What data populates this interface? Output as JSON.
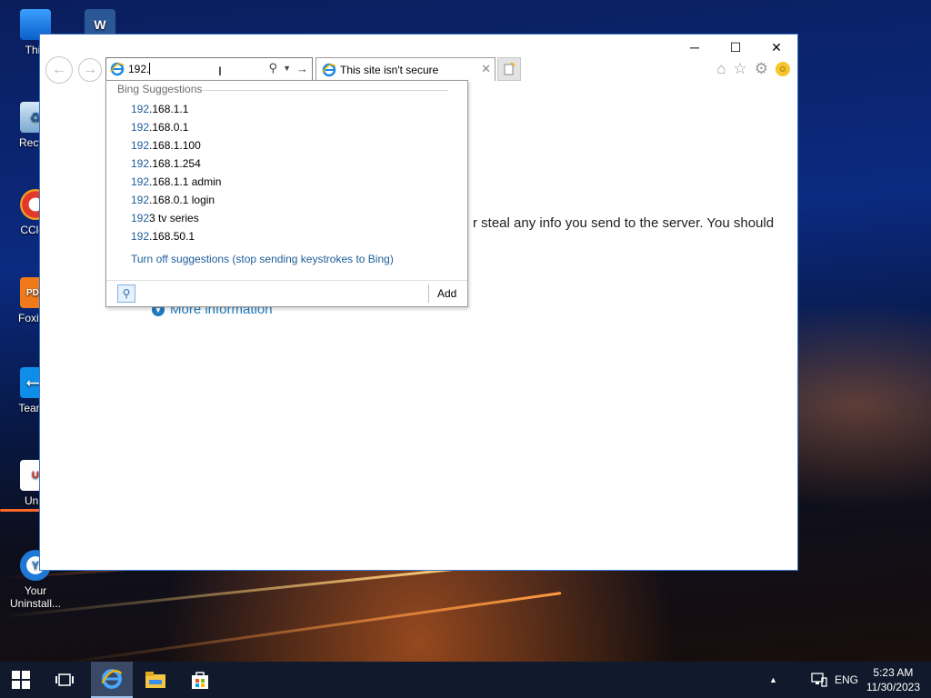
{
  "desktop": {
    "icons": [
      {
        "label": "This",
        "icon": "computer-icon"
      },
      {
        "label": "Recycl",
        "icon": "recycle-bin-icon"
      },
      {
        "label": "CClea",
        "icon": "ccleaner-icon"
      },
      {
        "label": "Foxit R",
        "icon": "foxit-reader-icon"
      },
      {
        "label": "TeamV",
        "icon": "teamviewer-icon"
      },
      {
        "label": "Unik",
        "icon": "unikey-icon"
      },
      {
        "label": "Your Uninstall...",
        "icon": "your-uninstaller-icon"
      }
    ],
    "word_icon_letter": "W"
  },
  "browser": {
    "window_controls": {
      "minimize": "─",
      "maximize": "☐",
      "close": "✕"
    },
    "address_value": "192.",
    "tab_title": "This site isn't secure",
    "body_text": "r steal any info you send to the server. You should",
    "more_info": "More information"
  },
  "suggestions": {
    "header": "Bing Suggestions",
    "items": [
      {
        "hl": "192",
        "rest": ".168.1.1"
      },
      {
        "hl": "192",
        "rest": ".168.0.1"
      },
      {
        "hl": "192",
        "rest": ".168.1.100"
      },
      {
        "hl": "192",
        "rest": ".168.1.254"
      },
      {
        "hl": "192",
        "rest": ".168.1.1 admin"
      },
      {
        "hl": "192",
        "rest": ".168.0.1 login"
      },
      {
        "hl": "192",
        "rest": "3 tv series"
      },
      {
        "hl": "192",
        "rest": ".168.50.1"
      }
    ],
    "turn_off": "Turn off suggestions (stop sending keystrokes to Bing)",
    "add_label": "Add"
  },
  "taskbar": {
    "language": "ENG",
    "time": "5:23 AM",
    "date": "11/30/2023"
  }
}
